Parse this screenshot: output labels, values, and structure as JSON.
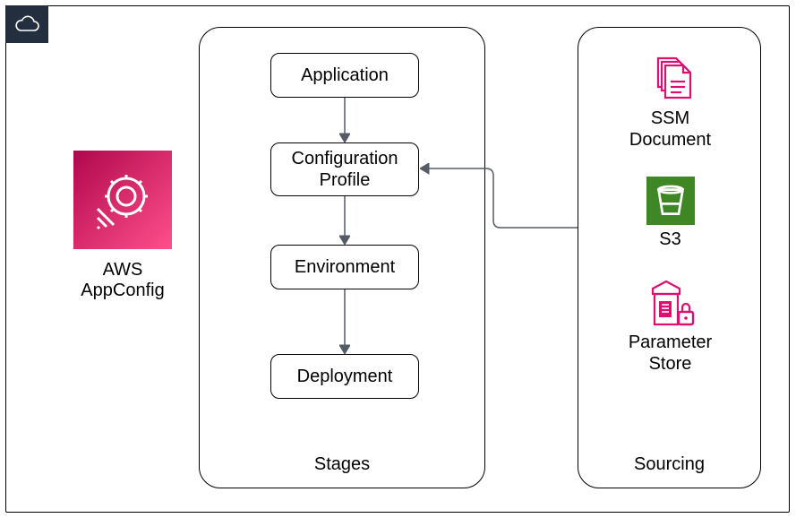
{
  "service": {
    "label": "AWS AppConfig",
    "icon_name": "appconfig-gear-icon"
  },
  "containers": {
    "stages": {
      "label": "Stages"
    },
    "sourcing": {
      "label": "Sourcing"
    }
  },
  "stages": {
    "items": [
      {
        "label": "Application"
      },
      {
        "label": "Configuration Profile"
      },
      {
        "label": "Environment"
      },
      {
        "label": "Deployment"
      }
    ]
  },
  "sources": {
    "items": [
      {
        "label": "SSM Document",
        "icon_name": "ssm-document-icon",
        "icon_color": "#DD0F6F"
      },
      {
        "label": "S3",
        "icon_name": "s3-bucket-icon",
        "icon_color": "#3F8624"
      },
      {
        "label": "Parameter Store",
        "icon_name": "parameter-store-icon",
        "icon_color": "#DD0F6F"
      }
    ]
  },
  "connections": [
    {
      "from": "Application",
      "to": "Configuration Profile",
      "dir": "down"
    },
    {
      "from": "Configuration Profile",
      "to": "Environment",
      "dir": "down"
    },
    {
      "from": "Environment",
      "to": "Deployment",
      "dir": "down"
    },
    {
      "from": "Sourcing",
      "to": "Configuration Profile",
      "dir": "left"
    }
  ],
  "colors": {
    "magenta": "#DD0F6F",
    "green": "#3F8624",
    "dark": "#232F3E",
    "arrow": "#545B64"
  }
}
